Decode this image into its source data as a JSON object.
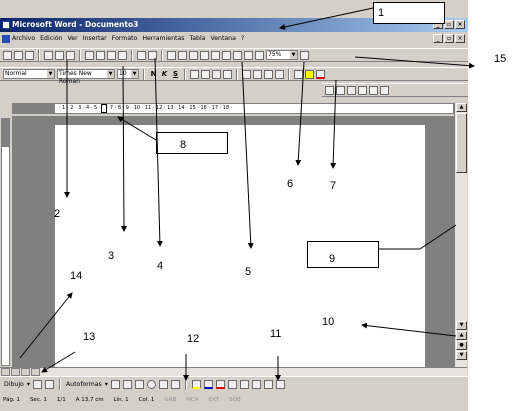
{
  "window": {
    "title": "Microsoft Word - Documento3"
  },
  "menu": [
    "Archivo",
    "Edición",
    "Ver",
    "Insertar",
    "Formato",
    "Herramientas",
    "Tabla",
    "Ventana",
    "?"
  ],
  "formatting": {
    "style": "Normal",
    "font": "Times New Roman",
    "size": "10",
    "bold": "N",
    "italic": "K",
    "underline": "S"
  },
  "zoom": "75%",
  "ruler_text": "· 1 · 2 · 3 · 4 · 5 · 6 · 7 · 8 · 9 · 10 · 11 · 12 · 13 · 14 · 15 · 16 · 17 · 18 ·",
  "drawing": {
    "dibujo": "Dibujo",
    "autoformas": "Autoformas"
  },
  "status": {
    "page": "Pág. 1",
    "section": "Sec. 1",
    "pages": "1/1",
    "position": "A 13,7 cm",
    "line": "Lín. 1",
    "column": "Col. 1",
    "rec": "GRB",
    "mcr": "MCA",
    "ext": "EXT",
    "sob": "SOB"
  },
  "callouts": {
    "c1": "1",
    "c2": "2",
    "c3": "3",
    "c4": "4",
    "c5": "5",
    "c6": "6",
    "c7": "7",
    "c8": "8",
    "c9": "9",
    "c10": "10",
    "c11": "11",
    "c12": "12",
    "c13": "13",
    "c14": "14",
    "c15": "15"
  },
  "colors": {
    "title_start": "#0a246a",
    "title_end": "#a6caf0",
    "chrome": "#d4d0c8"
  }
}
